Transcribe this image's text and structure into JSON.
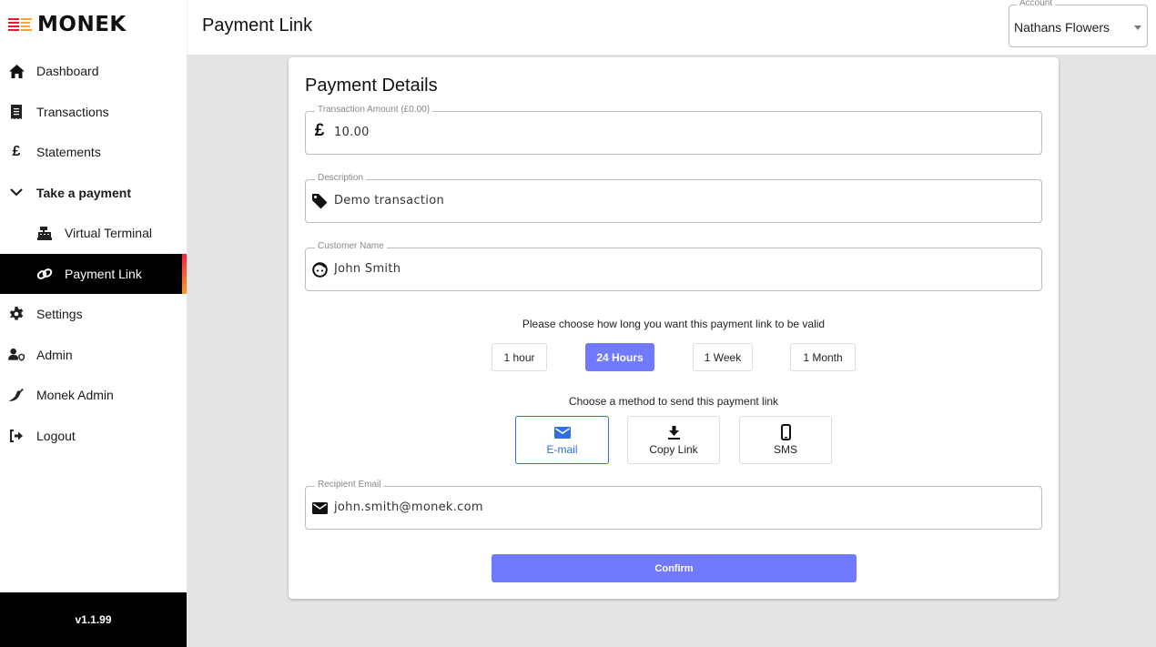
{
  "brand": {
    "name": "MONEK",
    "colors": {
      "red": "#e8192c",
      "orange": "#f6a43a",
      "accent": "#7179fe",
      "selected_blue": "#2f6fe0"
    }
  },
  "sidebar": {
    "items": [
      {
        "label": "Dashboard",
        "icon": "home-icon"
      },
      {
        "label": "Transactions",
        "icon": "receipt-icon"
      },
      {
        "label": "Statements",
        "icon": "pound-icon"
      },
      {
        "label": "Take a payment",
        "icon": "chevron-down-icon",
        "expanded": true
      },
      {
        "label": "Virtual Terminal",
        "icon": "cash-register-icon"
      },
      {
        "label": "Payment Link",
        "icon": "link-icon",
        "active": true
      },
      {
        "label": "Settings",
        "icon": "gear-icon"
      },
      {
        "label": "Admin",
        "icon": "user-shield-icon"
      },
      {
        "label": "Monek Admin",
        "icon": "pepper-icon"
      },
      {
        "label": "Logout",
        "icon": "logout-icon"
      }
    ],
    "version": "v1.1.99"
  },
  "header": {
    "title": "Payment Link",
    "account": {
      "label": "Account",
      "value": "Nathans Flowers"
    }
  },
  "card": {
    "title": "Payment Details",
    "fields": {
      "amount": {
        "label": "Transaction Amount (£0.00)",
        "value": "10.00",
        "icon": "pound-icon"
      },
      "description": {
        "label": "Description",
        "value": "Demo transaction",
        "icon": "tag-icon"
      },
      "customer": {
        "label": "Customer Name",
        "value": "John Smith",
        "icon": "face-icon"
      },
      "email": {
        "label": "Recipient Email",
        "value": "john.smith@monek.com",
        "icon": "envelope-icon"
      }
    },
    "validity_prompt": "Please choose how long you want this payment link to be valid",
    "durations": [
      {
        "label": "1 hour",
        "selected": false
      },
      {
        "label": "24 Hours",
        "selected": true
      },
      {
        "label": "1 Week",
        "selected": false
      },
      {
        "label": "1 Month",
        "selected": false
      }
    ],
    "method_prompt": "Choose a method to send this payment link",
    "methods": [
      {
        "label": "E-mail",
        "icon": "envelope-icon",
        "selected": true
      },
      {
        "label": "Copy Link",
        "icon": "download-icon",
        "selected": false
      },
      {
        "label": "SMS",
        "icon": "phone-icon",
        "selected": false
      }
    ],
    "confirm_label": "Confirm"
  }
}
